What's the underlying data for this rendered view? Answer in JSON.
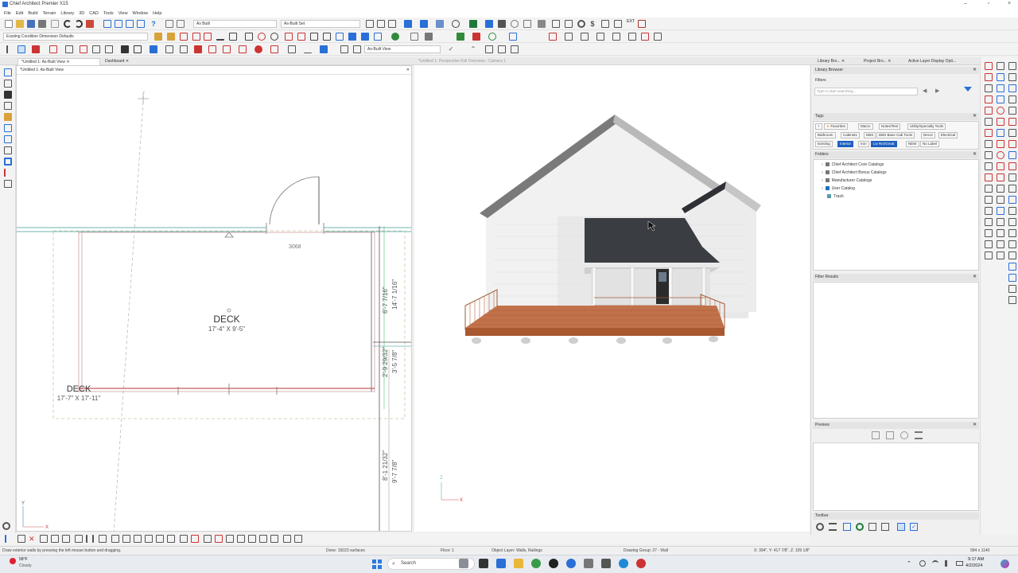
{
  "app": {
    "title": "Chief Architect Premier X15",
    "menu": [
      "File",
      "Edit",
      "Build",
      "Terrain",
      "Library",
      "3D",
      "CAD",
      "Tools",
      "View",
      "Window",
      "Help"
    ]
  },
  "toolbar": {
    "layer_set": "As Built",
    "layer_set2": "As-Built Set",
    "defaults_combo": "Existing Condition Dimension Defaults",
    "view_combo": "As-Built View",
    "ext_label": "EXT"
  },
  "tabs": {
    "plan_tab": "*Untitled 1: As-Built View",
    "dashboard_tab": "Dashboard",
    "camera_tab": "*Untitled 1: Perspective Full Overview - Camera 1",
    "right_tabs": [
      "Library Bro...",
      "Project Bro...",
      "Active Layer Display Opti..."
    ]
  },
  "plan": {
    "title": "*Untitled 1: As-Built View",
    "door_label": "3068",
    "room_name": "DECK",
    "room_size": "17'-4\" X 9'-5\"",
    "room2_name": "DECK",
    "room2_size": "17'-7\" X 17'-11\"",
    "dim_right1": "6'-7 7/16\"",
    "dim_right2": "14'-7 1/16\"",
    "dim_right3": "2'-9 29/32\"",
    "dim_right4": "3'-5 7/8\"",
    "dim_right5": "8'-1 21/32\"",
    "dim_right6": "9'-7 7/8\"",
    "axis_x": "X",
    "axis_y": "Y"
  },
  "camera": {
    "axis_x": "X",
    "axis_z": "Z"
  },
  "library": {
    "title": "Library Browser",
    "filters_label": "Filters",
    "search_placeholder": "Type to start searching...",
    "tags_label": "Tags",
    "tags": [
      "Favorites",
      "Macro",
      "Notes/Text",
      "Utility/Specialty Tools",
      "Bathroom",
      "Cabinets",
      "DBS",
      "DBS Base Cab Tools",
      "Decor",
      "Electrical",
      "Existing",
      "Interior",
      "Iron",
      "Liv Rm/Great",
      "NEW",
      "No Label"
    ],
    "selected_tags": [
      "Interior",
      "Liv Rm/Great"
    ],
    "folders_label": "Folders",
    "folders": [
      "Chief Architect Core Catalogs",
      "Chief Architect Bonus Catalogs",
      "Manufacturer Catalogs",
      "User Catalog",
      "Trash"
    ],
    "filter_results_label": "Filter Results",
    "preview_label": "Preview",
    "toolbar_label": "Toolbar"
  },
  "status": {
    "hint": "Draw exterior walls by pressing the left mouse button and dragging.",
    "done": "Done: 15023 surfaces",
    "floor": "Floor: 1",
    "object_layer": "Object Layer: Walls, Railings",
    "drawing_group": "Drawing Group: 27 - Wall",
    "coords": "X: 394\", Y: 417 7/8\", Z: 109 1/8\"",
    "size": "994 x 1140"
  },
  "taskbar": {
    "weather_temp": "58°F",
    "weather_desc": "Cloudy",
    "search": "Search",
    "time": "9:17 AM",
    "date": "4/2/2024"
  },
  "colors": {
    "accent": "#1e5fbf",
    "siding": "#eeeeee",
    "roof": "#3a3d42",
    "deck": "#b5653f"
  }
}
